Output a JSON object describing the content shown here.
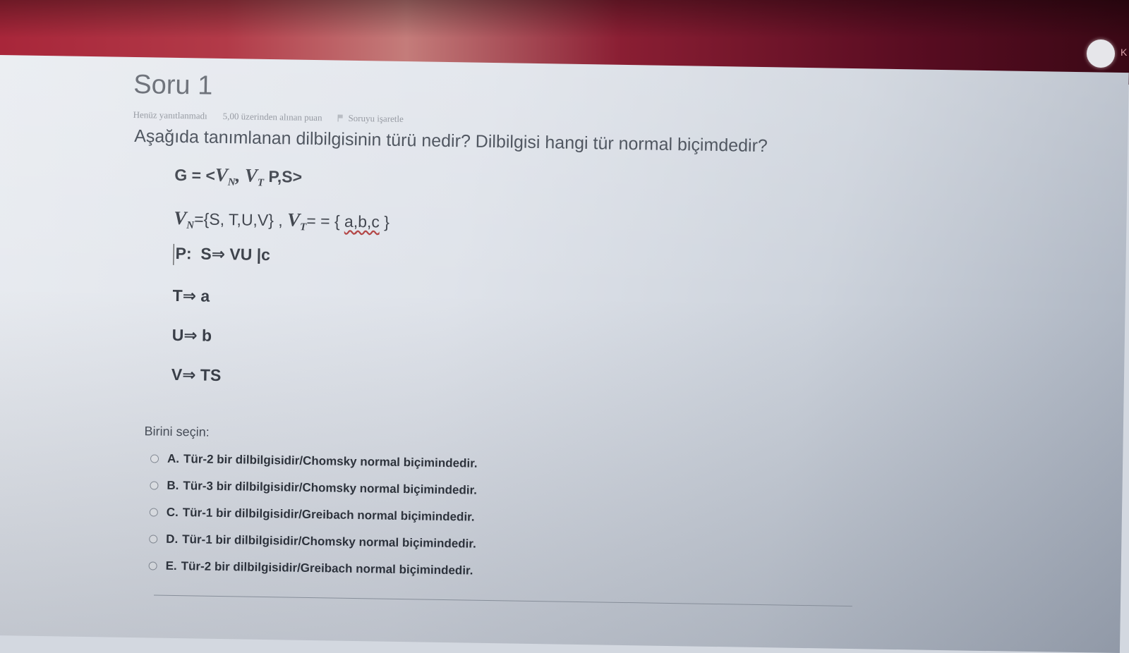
{
  "window": {
    "avatar_letter": "K"
  },
  "question": {
    "title": "Soru 1",
    "status": "Henüz yanıtlanmadı",
    "points": "5,00 üzerinden alınan puan",
    "flag_label": "Soruyu işaretle",
    "text": "Aşağıda tanımlanan dilbilgisinin türü nedir? Dilbilgisi hangi tür normal biçimdedir?"
  },
  "grammar": {
    "g_prefix": "G = <",
    "v": "V",
    "n": "N",
    "t": "T",
    "comma": ",",
    "g_suffix": " P,S>",
    "eq": "=",
    "vn_set": "{S, T,U,V}",
    "sep": " , ",
    "vt_eq": "= = {",
    "vt_set": "a,b,c",
    "close_brace": "}",
    "p_label": "P:",
    "rule_s": "S⇒ VU |c",
    "rule_t": "T⇒ a",
    "rule_u": "U⇒ b",
    "rule_v": "V⇒ TS"
  },
  "answer": {
    "prompt": "Birini seçin:",
    "options": [
      {
        "letter": "A.",
        "text": "Tür-2 bir dilbilgisidir/Chomsky normal biçimindedir."
      },
      {
        "letter": "B.",
        "text": "Tür-3 bir dilbilgisidir/Chomsky normal biçimindedir."
      },
      {
        "letter": "C.",
        "text": "Tür-1 bir dilbilgisidir/Greibach normal biçimindedir."
      },
      {
        "letter": "D.",
        "text": "Tür-1 bir dilbilgisidir/Chomsky normal biçimindedir."
      },
      {
        "letter": "E.",
        "text": "Tür-2 bir dilbilgisidir/Greibach normal biçimindedir."
      }
    ]
  }
}
